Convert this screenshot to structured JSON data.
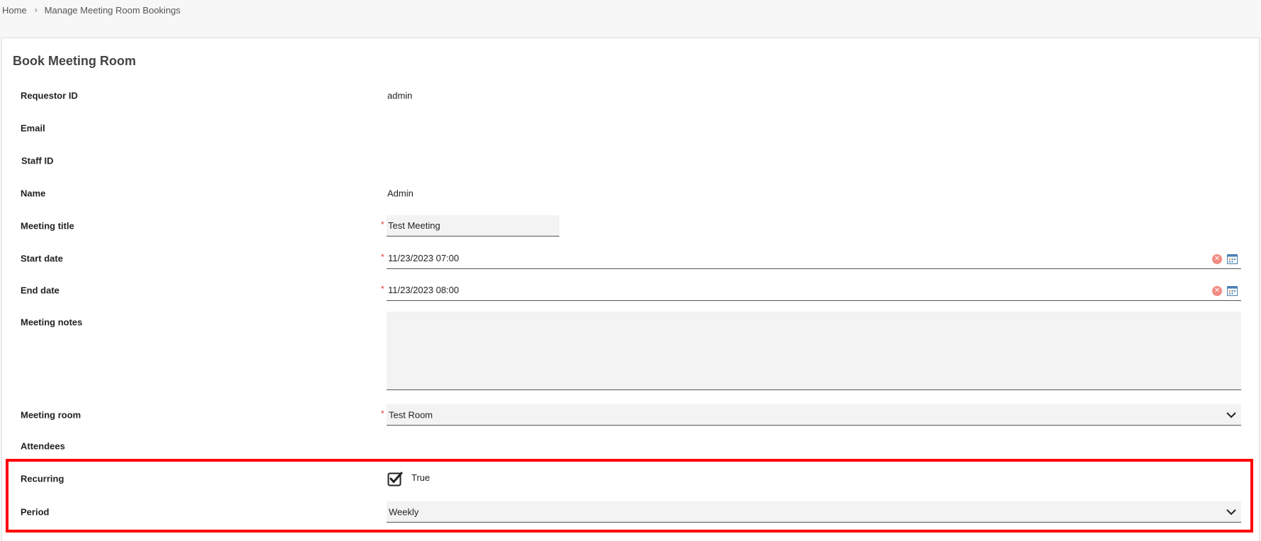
{
  "breadcrumb": {
    "home": "Home",
    "current": "Manage Meeting Room Bookings"
  },
  "form": {
    "title": "Book Meeting Room",
    "fields": {
      "requestor_id": {
        "label": "Requestor ID",
        "value": "admin"
      },
      "email": {
        "label": "Email",
        "value": ""
      },
      "staff_id": {
        "label": "Staff ID",
        "value": ""
      },
      "name": {
        "label": "Name",
        "value": "Admin"
      },
      "meeting_title": {
        "label": "Meeting title",
        "value": "Test Meeting",
        "required_mark": "*"
      },
      "start_date": {
        "label": "Start date",
        "value": "11/23/2023 07:00",
        "required_mark": "*"
      },
      "end_date": {
        "label": "End date",
        "value": "11/23/2023 08:00",
        "required_mark": "*"
      },
      "meeting_notes": {
        "label": "Meeting notes",
        "value": ""
      },
      "meeting_room": {
        "label": "Meeting room",
        "value": "Test Room",
        "required_mark": "*"
      },
      "attendees": {
        "label": "Attendees"
      },
      "recurring": {
        "label": "Recurring",
        "checked": true,
        "value_label": "True"
      },
      "period": {
        "label": "Period",
        "value": "Weekly"
      }
    }
  },
  "icons": {
    "clear": "clear-icon",
    "calendar": "calendar-icon",
    "chevron": "chevron-down-icon",
    "check": "checkbox-checked-icon"
  },
  "colors": {
    "required": "#e53935",
    "highlight": "#ff0000",
    "clear_icon": "#f28b82",
    "field_bg": "#f3f3f3"
  }
}
